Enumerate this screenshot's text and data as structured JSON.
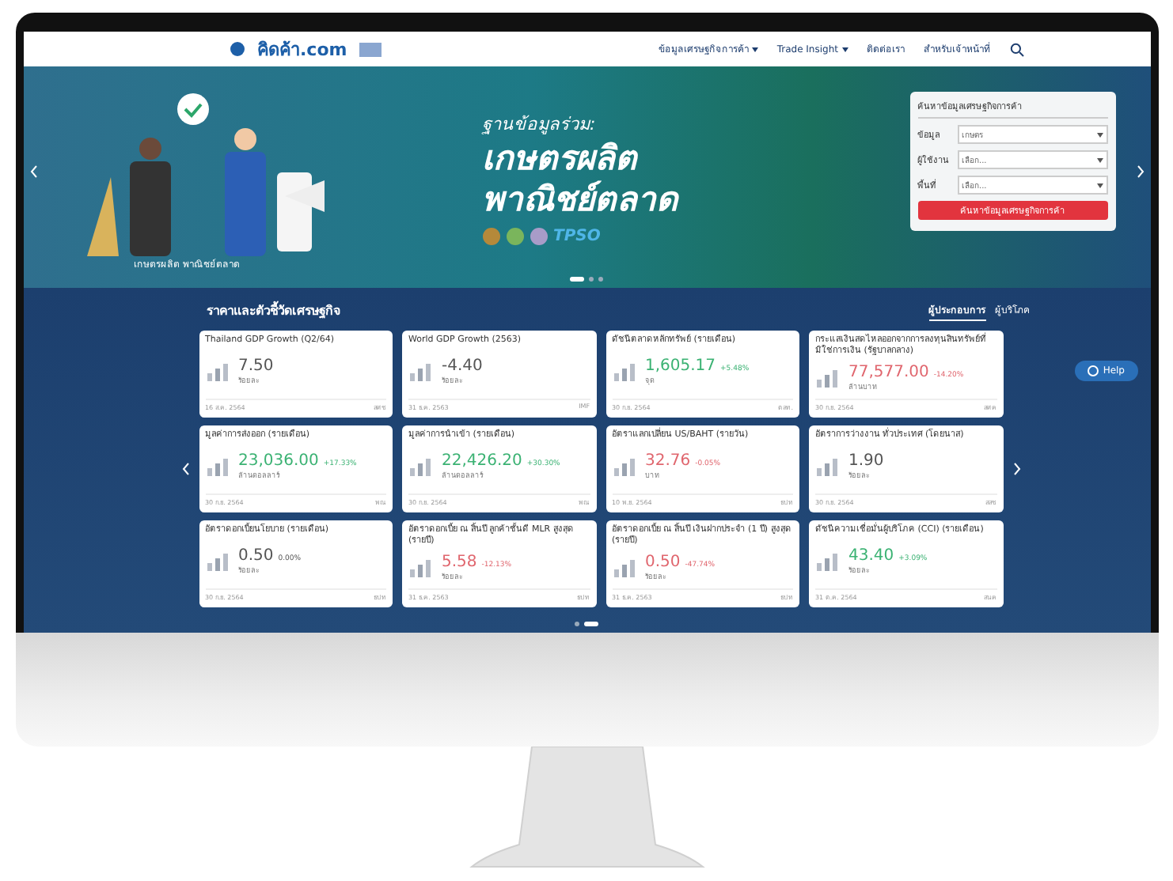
{
  "header": {
    "logo": "คิดค้า.com",
    "nav": [
      {
        "label": "ข้อมูลเศรษฐกิจการค้า",
        "dropdown": true
      },
      {
        "label": "Trade Insight",
        "dropdown": true
      },
      {
        "label": "ติดต่อเรา",
        "dropdown": false
      },
      {
        "label": "สำหรับเจ้าหน้าที่",
        "dropdown": false
      }
    ]
  },
  "hero": {
    "eyebrow": "ฐานข้อมูลร่วม:",
    "headline": [
      "เกษตรผลิต",
      "พาณิชย์ตลาด"
    ],
    "partner": "TPSO",
    "caption": "เกษตรผลิต พาณิชย์ตลาด",
    "slides": [
      {
        "selected": true
      },
      {
        "selected": false
      },
      {
        "selected": false
      }
    ],
    "search": {
      "title": "ค้นหาข้อมูลเศรษฐกิจการค้า",
      "fields": [
        {
          "label": "ข้อมูล",
          "value": "เกษตร"
        },
        {
          "label": "ผู้ใช้งาน",
          "value": "เลือก..."
        },
        {
          "label": "พื้นที่",
          "value": "เลือก..."
        }
      ],
      "button": "ค้นหาข้อมูลเศรษฐกิจการค้า"
    }
  },
  "indicators": {
    "title": "ราคาและตัวชี้วัดเศรษฐกิจ",
    "tabs": [
      {
        "label": "ผู้ประกอบการ",
        "selected": true
      },
      {
        "label": "ผู้บริโภค",
        "selected": false
      }
    ],
    "help": "Help",
    "pages": [
      {
        "selected": false
      },
      {
        "selected": true
      }
    ],
    "cards": [
      {
        "title": "Thailand GDP Growth (Q2/64)",
        "value": "7.50",
        "kind": "none",
        "unit": "ร้อยละ",
        "date": "16 ส.ค. 2564",
        "source": "สศช"
      },
      {
        "title": "World GDP Growth (2563)",
        "value": "-4.40",
        "kind": "none",
        "unit": "ร้อยละ",
        "date": "31 ธ.ค. 2563",
        "source": "IMF"
      },
      {
        "title": "ดัชนีตลาดหลักทรัพย์ (รายเดือน)",
        "value": "1,605.17",
        "change": "+5.48%",
        "kind": "up",
        "unit": "จุด",
        "date": "30 ก.ย. 2564",
        "source": "ตลท."
      },
      {
        "title": "กระแสเงินสดไหลออกจากการลงทุนสินทรัพย์ที่มิใช่การเงิน (รัฐบาลกลาง)",
        "value": "77,577.00",
        "change": "-14.20%",
        "kind": "down",
        "unit": "ล้านบาท",
        "date": "30 ก.ย. 2564",
        "source": "สศค"
      },
      {
        "title": "มูลค่าการส่งออก (รายเดือน)",
        "value": "23,036.00",
        "change": "+17.33%",
        "kind": "up",
        "unit": "ล้านดอลลาร์",
        "date": "30 ก.ย. 2564",
        "source": "พณ"
      },
      {
        "title": "มูลค่าการนำเข้า (รายเดือน)",
        "value": "22,426.20",
        "change": "+30.30%",
        "kind": "up",
        "unit": "ล้านดอลลาร์",
        "date": "30 ก.ย. 2564",
        "source": "พณ"
      },
      {
        "title": "อัตราแลกเปลี่ยน US/BAHT (รายวัน)",
        "value": "32.76",
        "change": "-0.05%",
        "kind": "down",
        "unit": "บาท",
        "date": "10 พ.ย. 2564",
        "source": "ธปท"
      },
      {
        "title": "อัตราการว่างงาน ทั่วประเทศ (โดยนาส)",
        "value": "1.90",
        "kind": "none",
        "unit": "ร้อยละ",
        "date": "30 ก.ย. 2564",
        "source": "สสช"
      },
      {
        "title": "อัตราดอกเบี้ยนโยบาย (รายเดือน)",
        "value": "0.50",
        "change": "0.00%",
        "kind": "none",
        "unit": "ร้อยละ",
        "date": "30 ก.ย. 2564",
        "source": "ธปท"
      },
      {
        "title": "อัตราดอกเบี้ย ณ สิ้นปี ลูกค้าชั้นดี MLR สูงสุด (รายปี)",
        "value": "5.58",
        "change": "-12.13%",
        "kind": "down",
        "unit": "ร้อยละ",
        "date": "31 ธ.ค. 2563",
        "source": "ธปท"
      },
      {
        "title": "อัตราดอกเบี้ย ณ สิ้นปี เงินฝากประจำ (1 ปี) สูงสุด (รายปี)",
        "value": "0.50",
        "change": "-47.74%",
        "kind": "down",
        "unit": "ร้อยละ",
        "date": "31 ธ.ค. 2563",
        "source": "ธปท"
      },
      {
        "title": "ดัชนีความเชื่อมั่นผู้บริโภค (CCI) (รายเดือน)",
        "value": "43.40",
        "change": "+3.09%",
        "kind": "up",
        "unit": "ร้อยละ",
        "date": "31 ต.ค. 2564",
        "source": "สนค"
      }
    ]
  }
}
